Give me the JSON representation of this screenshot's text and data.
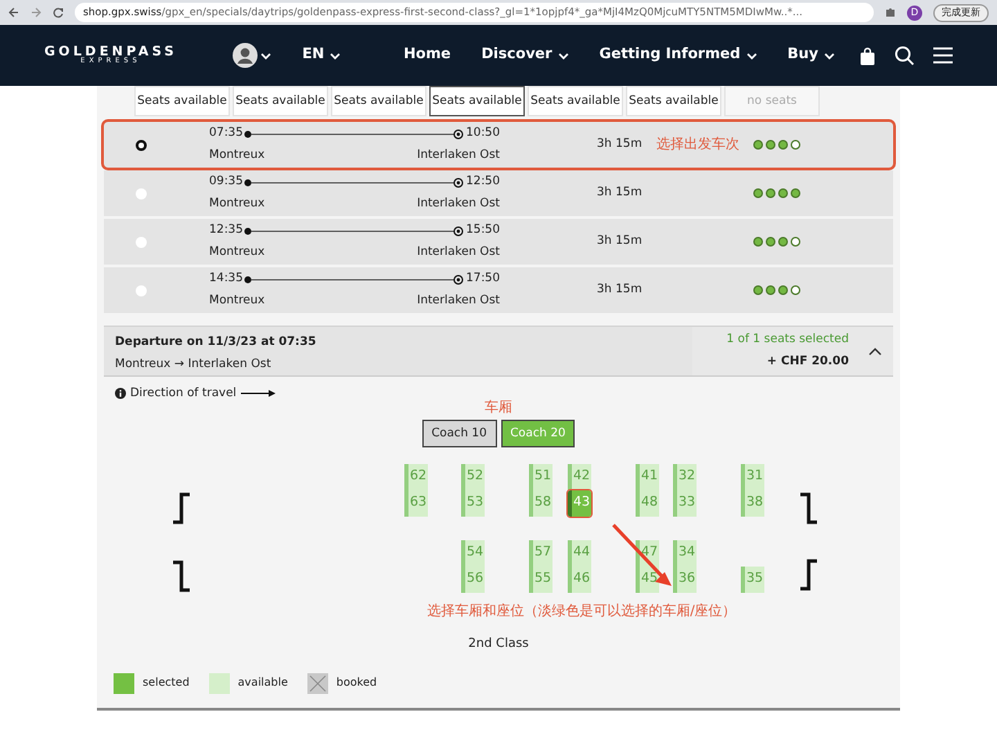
{
  "browser": {
    "url_host": "shop.gpx.swiss",
    "url_path": "/gpx_en/specials/daytrips/goldenpass-express-first-second-class?_gl=1*1opjpf4*_ga*MjI4MzQ0MjcuMTY5NTM5MDIwMw..*...",
    "profile_initial": "D",
    "update_button": "完成更新"
  },
  "navbar": {
    "logo": {
      "name": "GOLDENPASS",
      "sub": "EXPRESS"
    },
    "language": "EN",
    "links": [
      {
        "label": "Home",
        "dropdown": false
      },
      {
        "label": "Discover",
        "dropdown": true
      },
      {
        "label": "Getting Informed",
        "dropdown": true
      },
      {
        "label": "Buy",
        "dropdown": true
      }
    ]
  },
  "date_tabs": [
    {
      "label": "Seats available",
      "selected": false,
      "disabled": false
    },
    {
      "label": "Seats available",
      "selected": false,
      "disabled": false
    },
    {
      "label": "Seats available",
      "selected": false,
      "disabled": false
    },
    {
      "label": "Seats available",
      "selected": true,
      "disabled": false
    },
    {
      "label": "Seats available",
      "selected": false,
      "disabled": false
    },
    {
      "label": "Seats available",
      "selected": false,
      "disabled": false
    },
    {
      "label": "no seats",
      "selected": false,
      "disabled": true
    }
  ],
  "journeys": [
    {
      "departure_time": "07:35",
      "arrival_time": "10:50",
      "from": "Montreux",
      "to": "Interlaken Ost",
      "duration": "3h 15m",
      "stars": 3,
      "selected": true,
      "note": "选择出发车次"
    },
    {
      "departure_time": "09:35",
      "arrival_time": "12:50",
      "from": "Montreux",
      "to": "Interlaken Ost",
      "duration": "3h 15m",
      "stars": 4,
      "selected": false
    },
    {
      "departure_time": "12:35",
      "arrival_time": "15:50",
      "from": "Montreux",
      "to": "Interlaken Ost",
      "duration": "3h 15m",
      "stars": 3,
      "selected": false
    },
    {
      "departure_time": "14:35",
      "arrival_time": "17:50",
      "from": "Montreux",
      "to": "Interlaken Ost",
      "duration": "3h 15m",
      "stars": 3,
      "selected": false
    }
  ],
  "booking": {
    "title": "Departure on 11/3/23 at 07:35",
    "route": "Montreux → Interlaken Ost",
    "seats_selected": "1 of 1 seats selected",
    "price": "+ CHF 20.00",
    "expanded": true
  },
  "direction_label": "Direction of travel",
  "coach_note": "车厢",
  "coaches": [
    {
      "label": "Coach 10",
      "selected": false
    },
    {
      "label": "Coach 20",
      "selected": true
    }
  ],
  "seat_columns": [
    {
      "upper": [
        {
          "number": "62",
          "selected": false
        },
        {
          "number": "63",
          "selected": false
        }
      ]
    },
    {
      "upper": [
        {
          "number": "52",
          "selected": false
        },
        {
          "number": "53",
          "selected": false
        }
      ],
      "lower": [
        {
          "number": "54",
          "selected": false
        },
        {
          "number": "56",
          "selected": false
        }
      ]
    },
    {
      "upper": [
        {
          "number": "51",
          "selected": false
        },
        {
          "number": "58",
          "selected": false
        }
      ],
      "lower": [
        {
          "number": "57",
          "selected": false
        },
        {
          "number": "55",
          "selected": false
        }
      ]
    },
    {
      "upper": [
        {
          "number": "42",
          "selected": false
        },
        {
          "number": "43",
          "selected": true,
          "annotated": true
        }
      ],
      "lower": [
        {
          "number": "44",
          "selected": false
        },
        {
          "number": "46",
          "selected": false
        }
      ]
    },
    {
      "upper": [
        {
          "number": "41",
          "selected": false
        },
        {
          "number": "48",
          "selected": false
        }
      ],
      "lower": [
        {
          "number": "47",
          "selected": false
        },
        {
          "number": "45",
          "selected": false
        }
      ]
    },
    {
      "upper": [
        {
          "number": "32",
          "selected": false
        },
        {
          "number": "33",
          "selected": false
        }
      ],
      "lower": [
        {
          "number": "34",
          "selected": false
        },
        {
          "number": "36",
          "selected": false
        }
      ]
    },
    {
      "upper": [
        {
          "number": "31",
          "selected": false
        },
        {
          "number": "38",
          "selected": false
        }
      ],
      "lower": [
        {
          "number": "35",
          "selected": false
        }
      ]
    }
  ],
  "seat_note": "选择车厢和座位（淡绿色是可以选择的车厢/座位）",
  "class_label": "2nd Class",
  "legend": [
    {
      "kind": "selected",
      "label": "selected"
    },
    {
      "kind": "available",
      "label": "available"
    },
    {
      "kind": "booked",
      "label": "booked"
    }
  ]
}
